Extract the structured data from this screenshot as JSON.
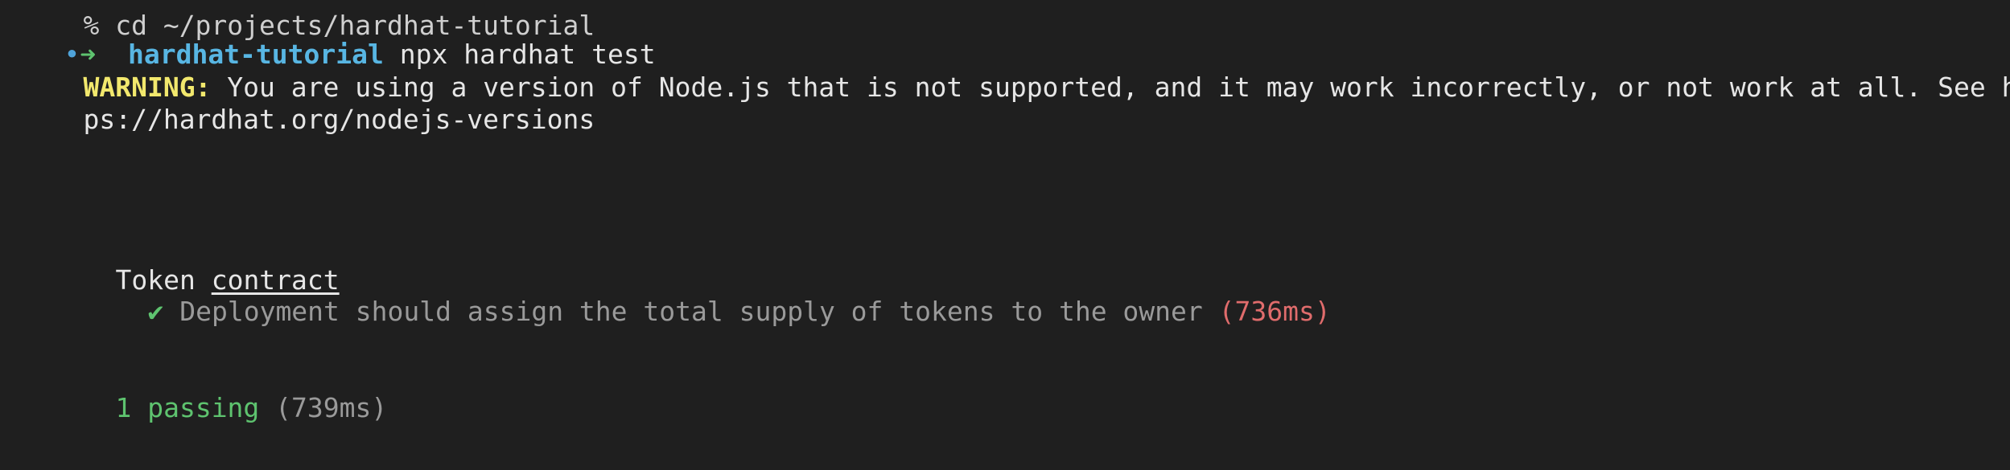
{
  "terminal": {
    "previous_line_fragment": "% cd ~/projects/hardhat-tutorial",
    "prompt": {
      "dot": "•",
      "arrow": "➜",
      "directory": "hardhat-tutorial",
      "command": "npx hardhat test"
    },
    "warning": {
      "label": "WARNING:",
      "text_line1": " You are using a version of Node.js that is not supported, and it may work incorrectly, or not work at all. See htt",
      "text_line2": "ps://hardhat.org/nodejs-versions"
    },
    "suite": {
      "name_prefix": "Token ",
      "name_underlined": "contract",
      "test": {
        "check": "✔",
        "title": "Deployment should assign the total supply of tokens to the owner",
        "duration": "(736ms)"
      }
    },
    "summary": {
      "passing": "1 passing",
      "duration": "(739ms)"
    }
  },
  "colors": {
    "background": "#1f1f1f",
    "directory": "#58b6e3",
    "warning": "#f2e86d",
    "pass": "#5ec36f",
    "slow": "#e06c6c"
  }
}
